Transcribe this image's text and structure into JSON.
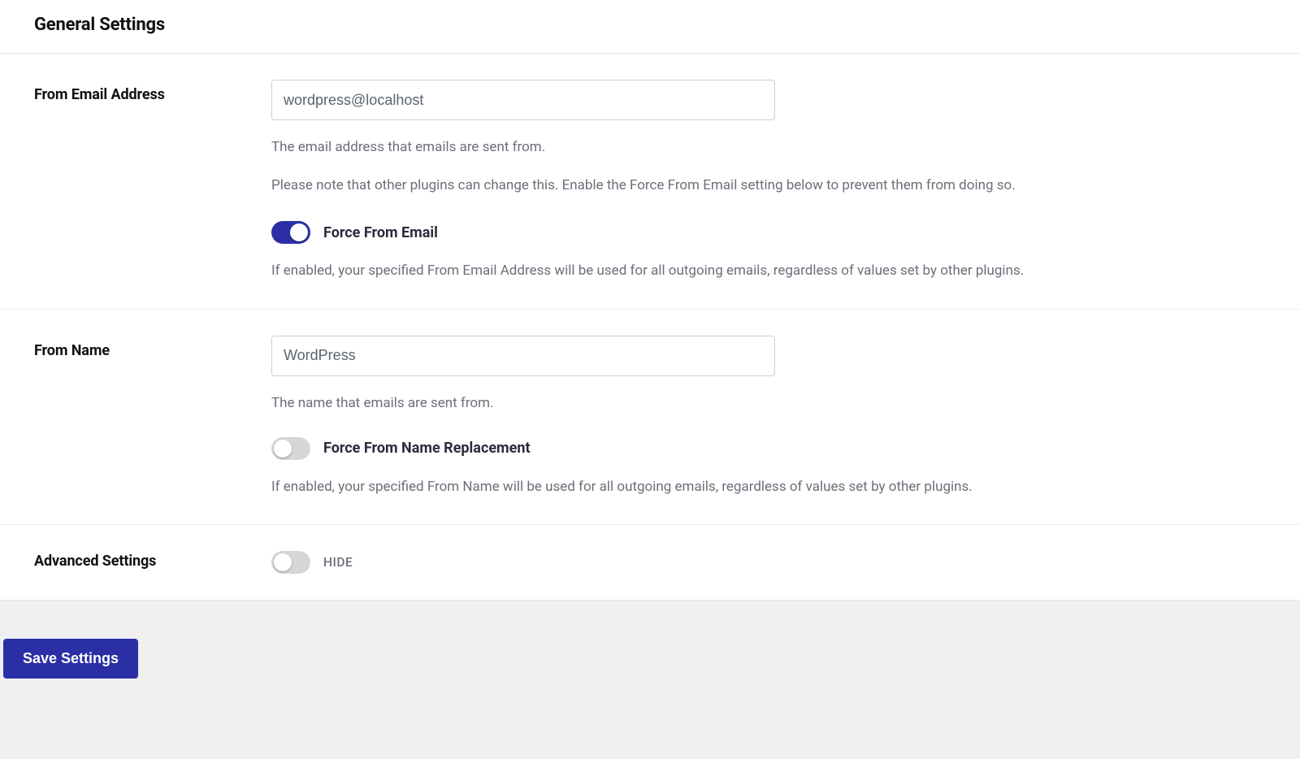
{
  "header": {
    "title": "General Settings"
  },
  "from_email": {
    "label": "From Email Address",
    "value": "wordpress@localhost",
    "desc1": "The email address that emails are sent from.",
    "desc2": "Please note that other plugins can change this. Enable the Force From Email setting below to prevent them from doing so.",
    "force_label": "Force From Email",
    "force_on": true,
    "force_desc": "If enabled, your specified From Email Address will be used for all outgoing emails, regardless of values set by other plugins."
  },
  "from_name": {
    "label": "From Name",
    "value": "WordPress",
    "desc1": "The name that emails are sent from.",
    "force_label": "Force From Name Replacement",
    "force_on": false,
    "force_desc": "If enabled, your specified From Name will be used for all outgoing emails, regardless of values set by other plugins."
  },
  "advanced": {
    "label": "Advanced Settings",
    "state_label": "HIDE",
    "on": false
  },
  "actions": {
    "save": "Save Settings"
  }
}
